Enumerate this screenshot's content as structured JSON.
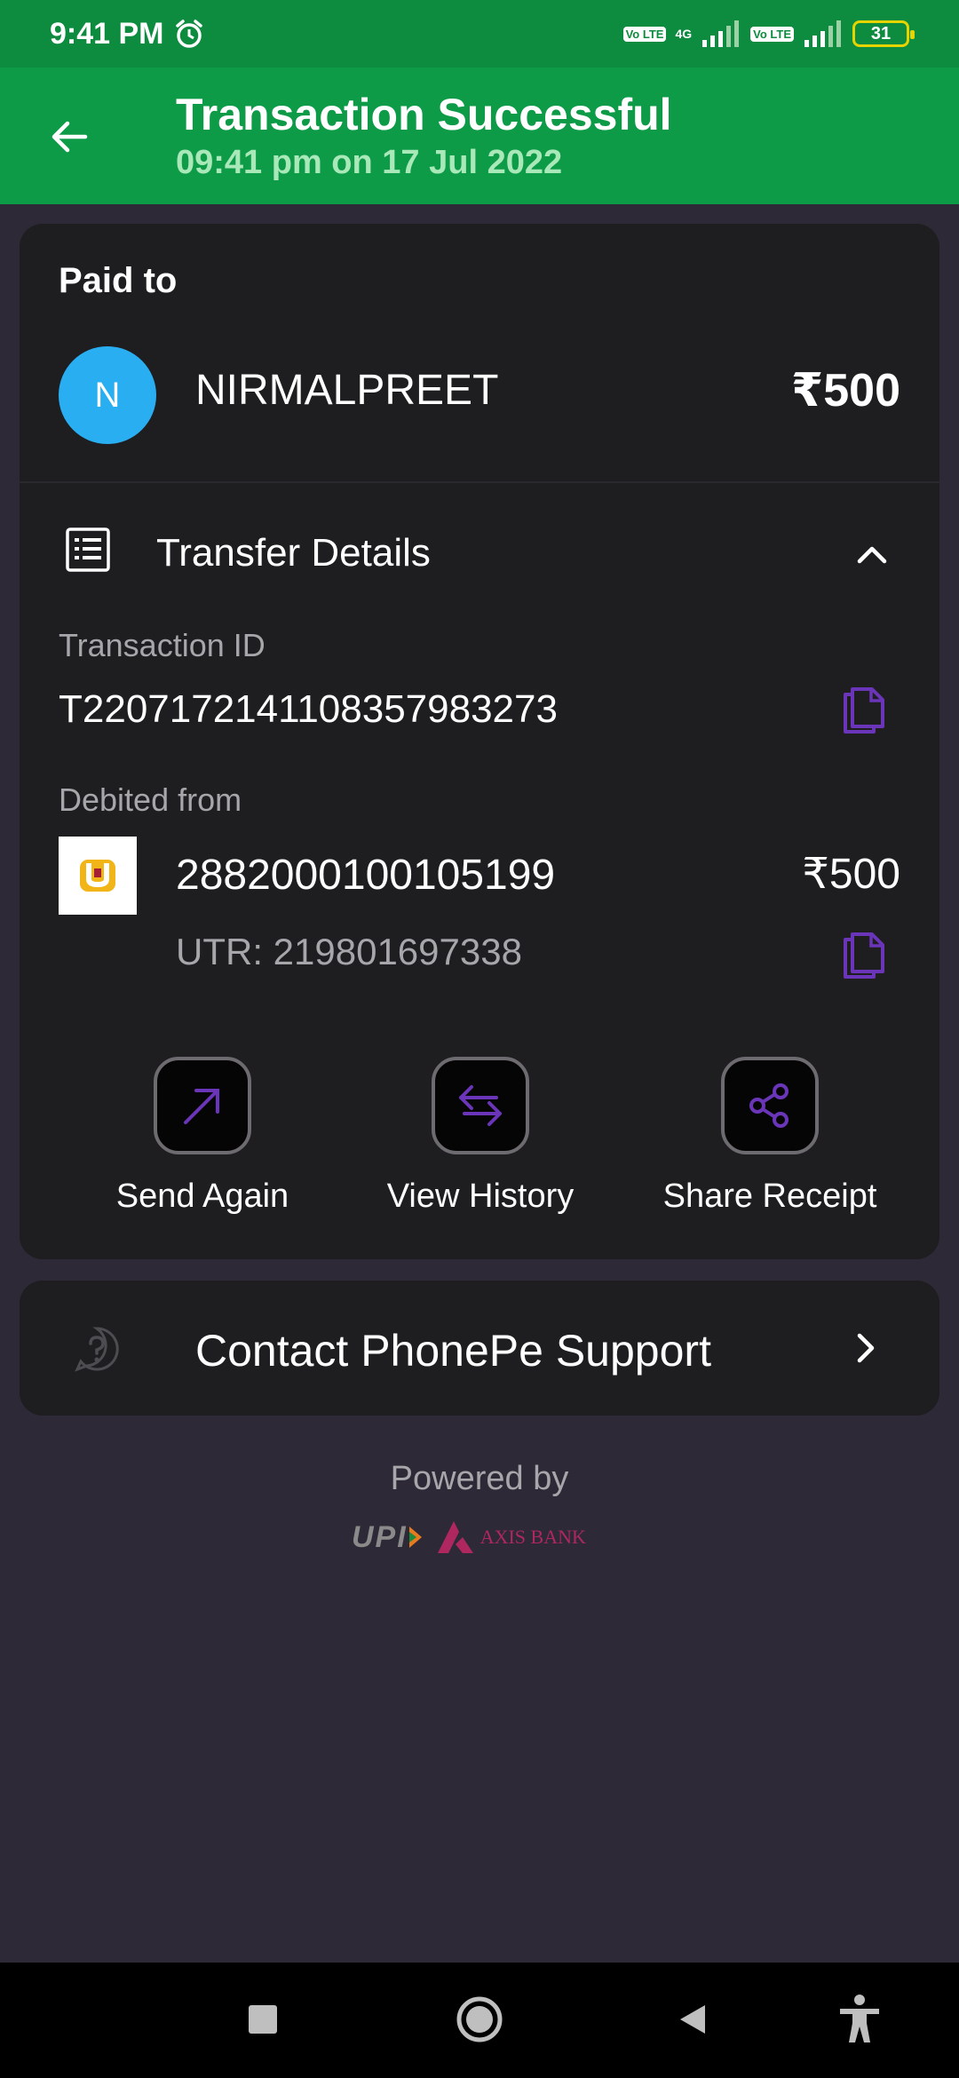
{
  "status_bar": {
    "time": "9:41 PM",
    "volte": "Vo LTE",
    "network": "4G",
    "battery": "31"
  },
  "header": {
    "title": "Transaction Successful",
    "subtitle": "09:41 pm on 17 Jul 2022"
  },
  "payment": {
    "paid_to_label": "Paid to",
    "avatar_initial": "N",
    "payee_name": "NIRMALPREET",
    "amount": "₹500"
  },
  "transfer_details": {
    "title": "Transfer Details",
    "transaction_id_label": "Transaction ID",
    "transaction_id": "T2207172141108357983273",
    "debited_from_label": "Debited from",
    "account_number": "2882000100105199",
    "account_amount": "₹500",
    "utr": "UTR: 219801697338"
  },
  "actions": {
    "send_again": "Send Again",
    "view_history": "View History",
    "share_receipt": "Share Receipt"
  },
  "support": {
    "label": "Contact PhonePe Support"
  },
  "footer": {
    "powered_by": "Powered by",
    "upi": "UPI",
    "bank": "AXIS BANK"
  },
  "colors": {
    "status_bar": "#0d8b3f",
    "header": "#0d9b47",
    "background": "#2e2936",
    "card": "#1e1d20",
    "accent_purple": "#6a35b8",
    "avatar": "#2aaef2"
  }
}
